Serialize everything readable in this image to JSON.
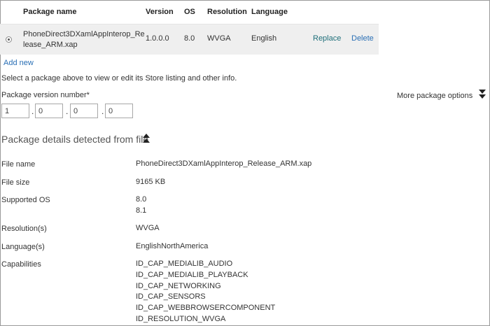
{
  "table": {
    "headers": {
      "name": "Package name",
      "version": "Version",
      "os": "OS",
      "resolution": "Resolution",
      "language": "Language"
    },
    "row": {
      "name_line1": "PhoneDirect3DXamlAppInterop_Re",
      "name_line2": "lease_ARM.xap",
      "version": "1.0.0.0",
      "os": "8.0",
      "resolution": "WVGA",
      "language": "English",
      "replace_label": "Replace",
      "delete_label": "Delete"
    }
  },
  "add_new_label": "Add new",
  "hint_text": "Select a package above to view or edit its Store listing and other info.",
  "version_number": {
    "label": "Package version number*",
    "parts": [
      "1",
      "0",
      "0",
      "0"
    ]
  },
  "more_options_label": "More package options",
  "details": {
    "title": "Package details detected from file",
    "file_name": {
      "label": "File name",
      "value": "PhoneDirect3DXamlAppInterop_Release_ARM.xap"
    },
    "file_size": {
      "label": "File size",
      "value": "9165 KB"
    },
    "supported_os": {
      "label": "Supported OS",
      "values": [
        "8.0",
        "8.1"
      ]
    },
    "resolutions": {
      "label": "Resolution(s)",
      "value": "WVGA"
    },
    "languages": {
      "label": "Language(s)",
      "value": "EnglishNorthAmerica"
    },
    "capabilities": {
      "label": "Capabilities",
      "values": [
        "ID_CAP_MEDIALIB_AUDIO",
        "ID_CAP_MEDIALIB_PLAYBACK",
        "ID_CAP_NETWORKING",
        "ID_CAP_SENSORS",
        "ID_CAP_WEBBROWSERCOMPONENT",
        "ID_RESOLUTION_WVGA"
      ]
    }
  }
}
